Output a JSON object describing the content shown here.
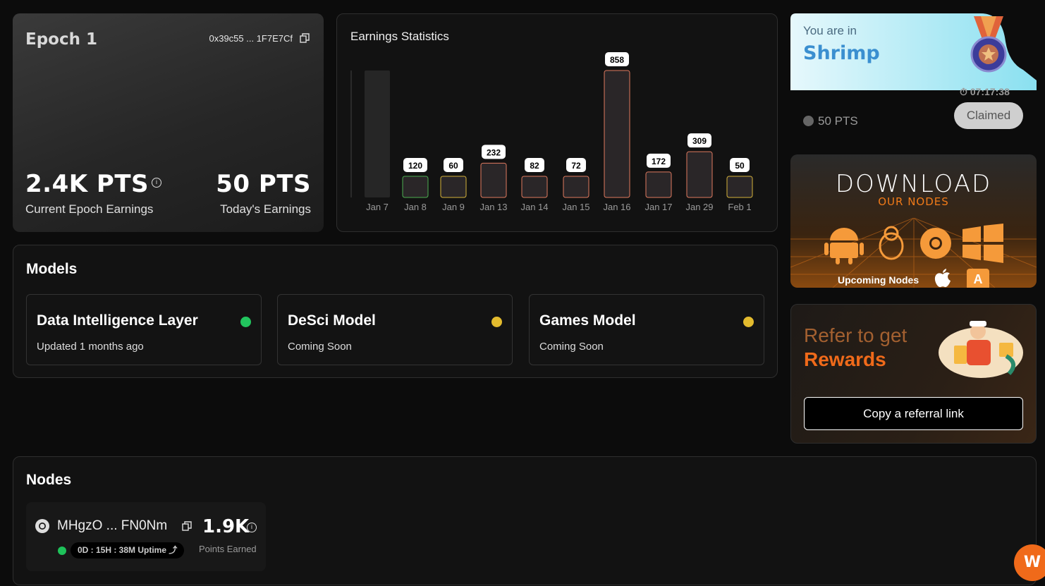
{
  "epoch": {
    "title": "Epoch 1",
    "address": "0x39c55 ... 1F7E7Cf",
    "current_value": "2.4K PTS",
    "current_label": "Current Epoch Earnings",
    "today_value": "50 PTS",
    "today_label": "Today's Earnings"
  },
  "chart_data": {
    "type": "bar",
    "title": "Earnings Statistics",
    "categories": [
      "Jan 7",
      "Jan 8",
      "Jan 9",
      "Jan 13",
      "Jan 14",
      "Jan 15",
      "Jan 16",
      "Jan 17",
      "Jan 29",
      "Feb 1"
    ],
    "values": [
      null,
      120,
      60,
      232,
      82,
      72,
      858,
      172,
      309,
      50
    ],
    "ylim": [
      0,
      858
    ],
    "grid": false,
    "colors": {
      "border": "#e07a5f",
      "green": "#4caf50",
      "yellow": "#d4b13a"
    }
  },
  "rank": {
    "label": "You are in",
    "tier": "Shrimp",
    "timer": "07:17:38",
    "points": "50 PTS",
    "claim_label": "Claimed"
  },
  "download": {
    "title": "DOWNLOAD",
    "subtitle": "OUR NODES",
    "upcoming": "Upcoming Nodes",
    "icons": [
      "android-icon",
      "linux-icon",
      "chrome-icon",
      "windows-icon",
      "apple-icon",
      "appstore-icon"
    ]
  },
  "refer": {
    "line1": "Refer to get",
    "line2": "Rewards",
    "button": "Copy a referral link"
  },
  "models": {
    "title": "Models",
    "items": [
      {
        "name": "Data Intelligence Layer",
        "status": "Updated 1 months ago",
        "dot_color": "#22c55e"
      },
      {
        "name": "DeSci Model",
        "status": "Coming Soon",
        "dot_color": "#e3bb2e"
      },
      {
        "name": "Games Model",
        "status": "Coming Soon",
        "dot_color": "#e3bb2e"
      }
    ]
  },
  "nodes": {
    "title": "Nodes",
    "items": [
      {
        "id": "MHgzO ... FN0Nm",
        "points": "1.9K",
        "points_label": "Points Earned",
        "uptime": "0D : 15H : 38M Uptime"
      }
    ]
  },
  "fab": {
    "label": "W"
  }
}
